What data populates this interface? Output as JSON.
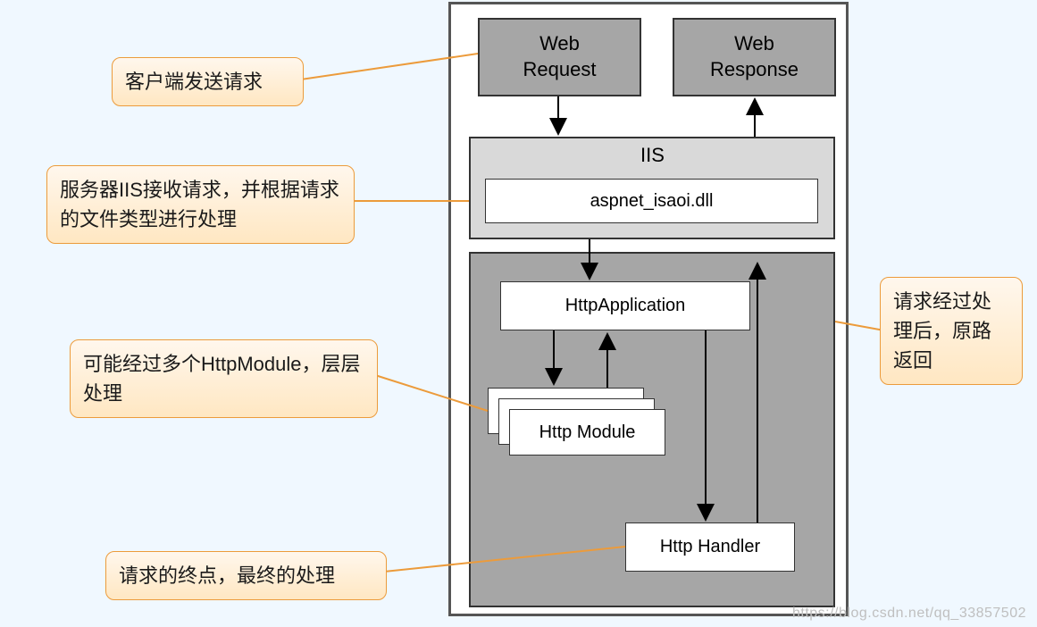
{
  "nodes": {
    "web_request": {
      "line1": "Web",
      "line2": "Request"
    },
    "web_response": {
      "line1": "Web",
      "line2": "Response"
    },
    "iis_label": "IIS",
    "aspnet_dll": "aspnet_isaoi.dll",
    "http_application": "HttpApplication",
    "http_module": "Http Module",
    "http_handler": "Http Handler"
  },
  "callouts": {
    "c1": "客户端发送请求",
    "c2": "服务器IIS接收请求，并根据请求的文件类型进行处理",
    "c3": "可能经过多个HttpModule，层层处理",
    "c4": "请求的终点，最终的处理",
    "c5": "请求经过处理后，原路返回"
  },
  "watermark": "https://blog.csdn.net/qq_33857502"
}
